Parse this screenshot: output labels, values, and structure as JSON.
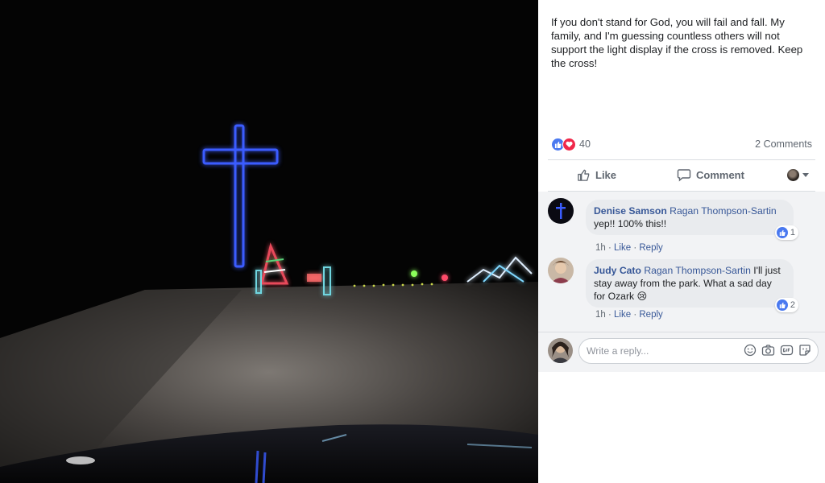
{
  "post": {
    "text": "If you don't stand for God, you will fail and fall. My family, and I'm guessing countless others will not support the light display if the cross is removed. Keep the cross!",
    "reaction_count": "40",
    "comments_count": "2 Comments"
  },
  "actions": {
    "like_label": "Like",
    "comment_label": "Comment"
  },
  "comments": [
    {
      "author": "Denise Samson",
      "tag": "Ragan Thompson-Sartin",
      "text": "yep!! 100% this!!",
      "time": "1h",
      "like_label": "Like",
      "reply_label": "Reply",
      "likes": "1"
    },
    {
      "author": "Judy Cato",
      "tag": "Ragan Thompson-Sartin",
      "text": "I'll just stay away from the park. What a sad day for Ozark 😢",
      "time": "1h",
      "like_label": "Like",
      "reply_label": "Reply",
      "likes": "2"
    }
  ],
  "reply": {
    "placeholder": "Write a reply..."
  },
  "icons": {
    "reaction_like": "thumbs-up-icon",
    "reaction_love": "heart-icon",
    "like_action": "thumbs-up-outline-icon",
    "comment_action": "speech-bubble-icon",
    "emoji": "smiley-icon",
    "camera": "camera-icon",
    "gif": "gif-icon",
    "sticker": "sticker-icon"
  },
  "colors": {
    "link": "#385898",
    "like_blue": "#4a79f0",
    "love_red": "#f0284a",
    "cross_blue": "#3a5cff"
  }
}
